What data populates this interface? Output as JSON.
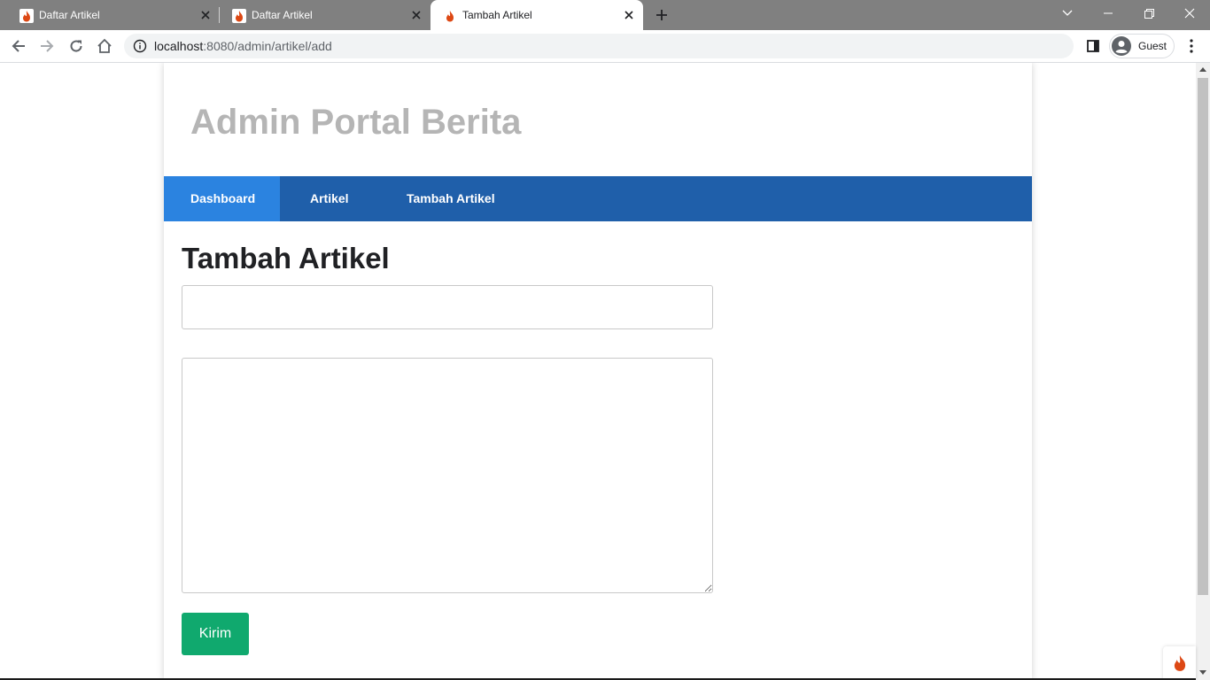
{
  "browser": {
    "tabs": [
      {
        "title": "Daftar Artikel",
        "active": false
      },
      {
        "title": "Daftar Artikel",
        "active": false
      },
      {
        "title": "Tambah Artikel",
        "active": true
      }
    ],
    "url": {
      "host": "localhost",
      "path": ":8080/admin/artikel/add"
    },
    "profile_name": "Guest",
    "colors": {
      "tabbar": "#808080",
      "active_tab": "#ffffff",
      "omnibox": "#f1f3f4"
    }
  },
  "site": {
    "title": "Admin Portal Berita",
    "nav": [
      {
        "label": "Dashboard",
        "active": true
      },
      {
        "label": "Artikel",
        "active": false
      },
      {
        "label": "Tambah Artikel",
        "active": false
      }
    ],
    "colors": {
      "navbar": "#1f5faa",
      "nav_active": "#2b83e0",
      "submit": "#10a96e",
      "title": "#b5b5b5"
    }
  },
  "form": {
    "heading": "Tambah Artikel",
    "title_value": "",
    "content_value": "",
    "submit_label": "Kirim"
  }
}
